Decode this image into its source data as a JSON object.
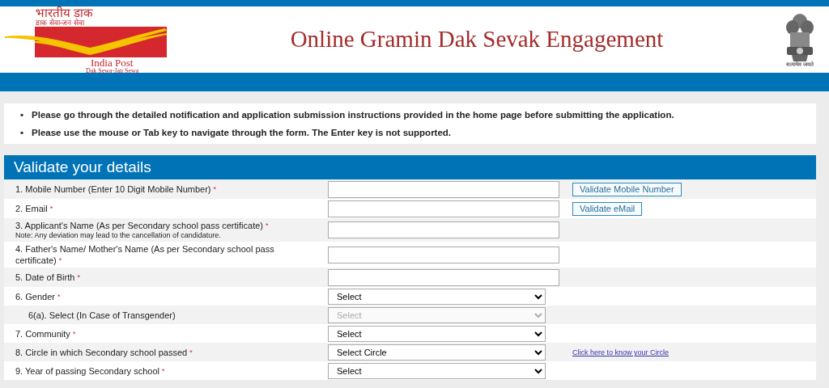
{
  "header": {
    "logo_hindi_title": "भारतीय डाक",
    "logo_hindi_tagline": "डाक सेवा-जन सेवा",
    "logo_name": "India Post",
    "logo_tagline": "Dak Sewa-Jan Sewa",
    "title": "Online Gramin Dak Sevak Engagement",
    "emblem_motto": "सत्यमेव जयते"
  },
  "notices": [
    {
      "bullet": "•",
      "text": "Please go through the detailed notification and application submission instructions provided in the home page before submitting the application."
    },
    {
      "bullet": "•",
      "text": "Please use the mouse or Tab key to navigate through the form. The Enter key is not supported."
    }
  ],
  "section_title": "Validate your details",
  "fields": [
    {
      "label": "1. Mobile Number (Enter 10 Digit Mobile Number)",
      "required_mark": "*",
      "kind": "text",
      "action": {
        "kind": "button",
        "label": "Validate Mobile Number"
      }
    },
    {
      "label": "2. Email",
      "required_mark": "*",
      "kind": "text",
      "action": {
        "kind": "button",
        "label": "Validate eMail"
      }
    },
    {
      "label": "3. Applicant's Name (As per Secondary school pass certificate)",
      "required_mark": "*",
      "note": "Note: Any deviation may lead to the cancellation of candidature.",
      "kind": "text"
    },
    {
      "label": "4. Father's Name/ Mother's Name (As per Secondary school pass certificate)",
      "required_mark": "*",
      "kind": "text"
    },
    {
      "label": "5. Date of Birth",
      "required_mark": "*",
      "kind": "text"
    },
    {
      "label": "6. Gender",
      "required_mark": "*",
      "kind": "select",
      "value": "Select",
      "disabled": false,
      "children": [
        {
          "label": "6(a). Select (In Case of Transgender)",
          "kind": "select",
          "value": "Select",
          "disabled": true
        }
      ]
    },
    {
      "label": "7. Community",
      "required_mark": "*",
      "kind": "select",
      "value": "Select",
      "disabled": false
    },
    {
      "label": "8. Circle in which Secondary school passed",
      "required_mark": "*",
      "kind": "select",
      "value": "Select Circle",
      "disabled": false,
      "action": {
        "kind": "link",
        "label": "Click here to know your Circle"
      }
    },
    {
      "label": "9. Year of passing Secondary school",
      "required_mark": "*",
      "kind": "select",
      "value": "Select",
      "disabled": false
    }
  ]
}
